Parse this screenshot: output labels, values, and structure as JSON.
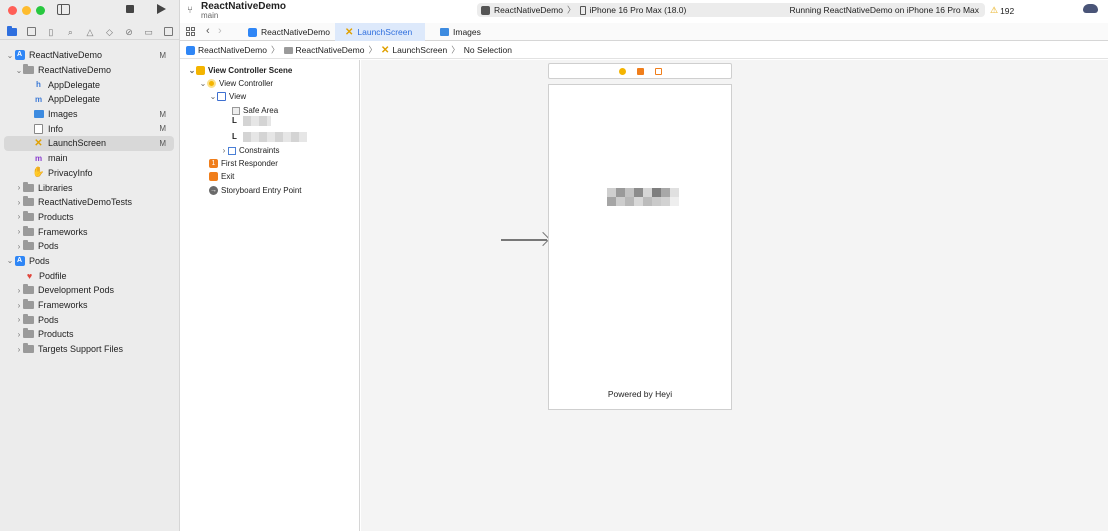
{
  "window": {
    "project_title": "ReactNativeDemo",
    "project_branch": "main"
  },
  "toolbar": {
    "scheme": "ReactNativeDemo",
    "scheme_separator": "〉",
    "device": "iPhone 16 Pro Max (18.0)",
    "status": "Running ReactNativeDemo on iPhone 16 Pro Max",
    "warning_count": "192",
    "warning_glyph": "⚠"
  },
  "navigator": {
    "items": [
      {
        "label": "ReactNativeDemo",
        "badge": "M",
        "disclosure": "⌄",
        "icon": "app-icon"
      },
      {
        "label": "ReactNativeDemo",
        "badge": "",
        "disclosure": "⌄",
        "icon": "folder-icon"
      },
      {
        "label": "AppDelegate",
        "badge": "",
        "disclosure": "",
        "icon": "header-file-icon",
        "glyph": "h"
      },
      {
        "label": "AppDelegate",
        "badge": "",
        "disclosure": "",
        "icon": "objc-file-icon",
        "glyph": "m"
      },
      {
        "label": "Images",
        "badge": "M",
        "disclosure": "",
        "icon": "asset-catalog-icon"
      },
      {
        "label": "Info",
        "badge": "M",
        "disclosure": "",
        "icon": "plist-icon"
      },
      {
        "label": "LaunchScreen",
        "badge": "M",
        "disclosure": "",
        "icon": "storyboard-icon",
        "glyph": "✕",
        "selected": true
      },
      {
        "label": "main",
        "badge": "",
        "disclosure": "",
        "icon": "main-file-icon",
        "glyph": "m"
      },
      {
        "label": "PrivacyInfo",
        "badge": "",
        "disclosure": "",
        "icon": "privacy-icon",
        "glyph": "✋"
      },
      {
        "label": "Libraries",
        "badge": "",
        "disclosure": "›",
        "icon": "folder-icon"
      },
      {
        "label": "ReactNativeDemoTests",
        "badge": "",
        "disclosure": "›",
        "icon": "folder-icon"
      },
      {
        "label": "Products",
        "badge": "",
        "disclosure": "›",
        "icon": "folder-icon"
      },
      {
        "label": "Frameworks",
        "badge": "",
        "disclosure": "›",
        "icon": "folder-icon"
      },
      {
        "label": "Pods",
        "badge": "",
        "disclosure": "›",
        "icon": "folder-icon"
      },
      {
        "label": "Pods",
        "badge": "",
        "disclosure": "⌄",
        "icon": "app-icon"
      },
      {
        "label": "Podfile",
        "badge": "",
        "disclosure": "",
        "icon": "podfile-icon",
        "glyph": "♥"
      },
      {
        "label": "Development Pods",
        "badge": "",
        "disclosure": "›",
        "icon": "folder-icon"
      },
      {
        "label": "Frameworks",
        "badge": "",
        "disclosure": "›",
        "icon": "folder-icon"
      },
      {
        "label": "Pods",
        "badge": "",
        "disclosure": "›",
        "icon": "folder-icon"
      },
      {
        "label": "Products",
        "badge": "",
        "disclosure": "›",
        "icon": "folder-icon"
      },
      {
        "label": "Targets Support Files",
        "badge": "",
        "disclosure": "›",
        "icon": "folder-icon"
      }
    ]
  },
  "tabs": [
    {
      "label": "ReactNativeDemo",
      "icon": "app-icon"
    },
    {
      "label": "LaunchScreen",
      "icon": "storyboard-icon",
      "active": true
    },
    {
      "label": "Images",
      "icon": "asset-catalog-icon"
    }
  ],
  "breadcrumb": {
    "items": [
      "ReactNativeDemo",
      "ReactNativeDemo",
      "LaunchScreen",
      "No Selection"
    ],
    "separator": "〉"
  },
  "outline": {
    "scene": "View Controller Scene",
    "view_controller": "View Controller",
    "view": "View",
    "safe_area": "Safe Area",
    "label_glyph": "L",
    "constraints": "Constraints",
    "first_responder": "First Responder",
    "first_responder_glyph": "1",
    "exit": "Exit",
    "entry_point": "Storyboard Entry Point",
    "entry_glyph": "→"
  },
  "canvas": {
    "footer_label": "Powered by Heyi"
  }
}
